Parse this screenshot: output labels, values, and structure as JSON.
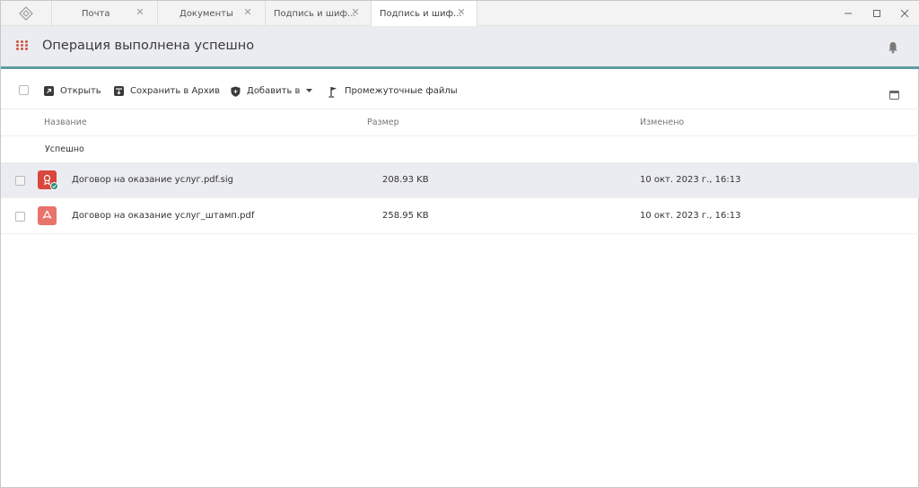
{
  "tabs": [
    {
      "label": "Почта"
    },
    {
      "label": "Документы"
    },
    {
      "label": "Подпись и шиф..."
    },
    {
      "label": "Подпись и шиф...",
      "active": true
    }
  ],
  "header": {
    "title": "Операция выполнена успешно"
  },
  "toolbar": {
    "open_label": "Открыть",
    "save_label": "Сохранить в Архив",
    "add_label": "Добавить в",
    "intermediate_label": "Промежуточные файлы"
  },
  "columns": {
    "name": "Название",
    "size": "Размер",
    "modified": "Изменено"
  },
  "group": {
    "label": "Успешно"
  },
  "files": [
    {
      "name": "Договор на оказание услуг.pdf.sig",
      "size": "208.93 KB",
      "modified": "10 окт. 2023 г., 16:13",
      "icon": "signature-file-icon",
      "selected": true
    },
    {
      "name": "Договор на оказание услуг_штамп.pdf",
      "size": "258.95 KB",
      "modified": "10 окт. 2023 г., 16:13",
      "icon": "pdf-file-icon",
      "selected": false
    }
  ],
  "colors": {
    "accent": "#5f9ea0",
    "brand_dot": "#d0533f",
    "header_bg": "#ebecf1",
    "sig_icon": "#d9463b",
    "pdf_icon": "#e8736a",
    "check_badge": "#1f8a7a"
  }
}
